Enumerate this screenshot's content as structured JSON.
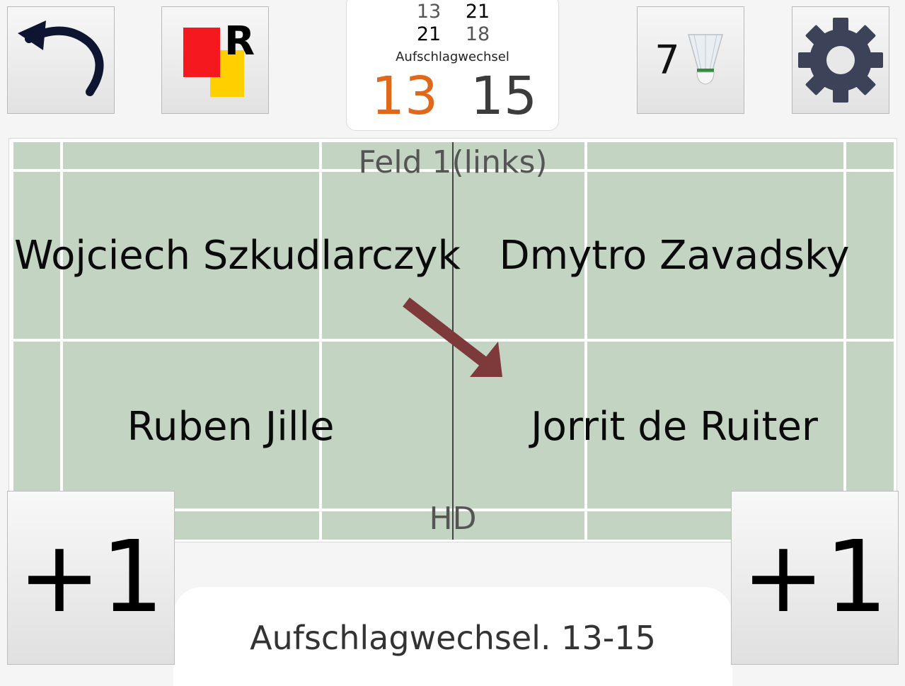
{
  "toolbar": {
    "undo_icon": "undo-icon",
    "cards_icon": "cards-referee-icon",
    "shuttle_count": "7",
    "shuttle_icon": "shuttlecock-icon",
    "settings_icon": "gear-icon"
  },
  "scoreboard": {
    "sets": [
      {
        "left": "13",
        "right": "21"
      },
      {
        "left": "21",
        "right": "18"
      }
    ],
    "serve_change_label": "Aufschlagwechsel",
    "score_left": "13",
    "score_right": "15"
  },
  "court": {
    "field_label": "Feld 1(links)",
    "discipline": "HD",
    "players": {
      "top_left": "Wojciech Szkudlarczyk",
      "top_right": "Dmytro Zavadsky",
      "bottom_left": "Ruben Jille",
      "bottom_right": "Jorrit de Ruiter"
    }
  },
  "buttons": {
    "plus_left": "+1",
    "plus_right": "+1"
  },
  "status_message": "Aufschlagwechsel. 13-15",
  "colors": {
    "left_score": "#e0681a",
    "court_fill": "#c3d4c3",
    "serve_arrow": "#7e3a3a"
  }
}
